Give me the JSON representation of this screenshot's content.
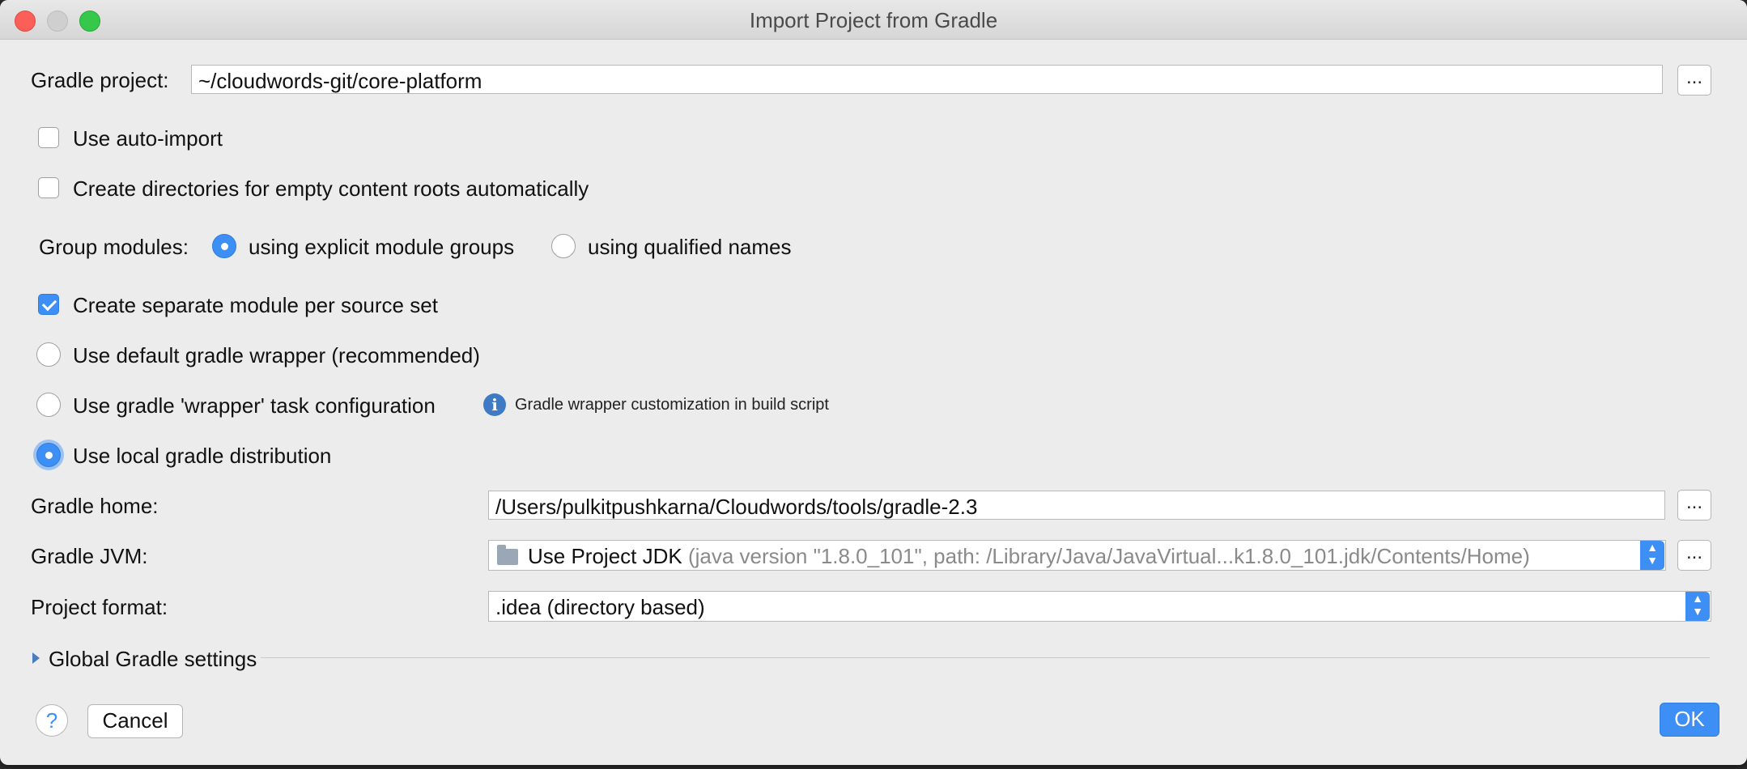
{
  "window": {
    "title": "Import Project from Gradle"
  },
  "gradle_project": {
    "label": "Gradle project:",
    "value": "~/cloudwords-git/core-platform",
    "browse_label": "..."
  },
  "options": {
    "auto_import": {
      "label": "Use auto-import",
      "checked": false
    },
    "create_dirs": {
      "label": "Create directories for empty content roots automatically",
      "checked": false
    },
    "group_modules": {
      "label": "Group modules:",
      "option_explicit": "using explicit module groups",
      "option_qualified": "using qualified names",
      "selected": "using explicit module groups"
    },
    "separate_module": {
      "label": "Create separate module per source set",
      "checked": true
    },
    "default_wrapper": {
      "label": "Use default gradle wrapper (recommended)",
      "selected": false
    },
    "wrapper_task": {
      "label": "Use gradle 'wrapper' task configuration",
      "selected": false,
      "info_text": "Gradle wrapper customization in build script"
    },
    "local_distribution": {
      "label": "Use local gradle distribution",
      "selected": true
    }
  },
  "gradle_home": {
    "label": "Gradle home:",
    "value": "/Users/pulkitpushkarna/Cloudwords/tools/gradle-2.3",
    "browse_label": "..."
  },
  "gradle_jvm": {
    "label": "Gradle JVM:",
    "value_main": "Use Project JDK",
    "value_detail": "(java version \"1.8.0_101\", path: /Library/Java/JavaVirtual...k1.8.0_101.jdk/Contents/Home)",
    "browse_label": "..."
  },
  "project_format": {
    "label": "Project format:",
    "value": ".idea (directory based)"
  },
  "global_settings": {
    "label": "Global Gradle settings"
  },
  "footer": {
    "help_label": "?",
    "cancel_label": "Cancel",
    "ok_label": "OK"
  },
  "colors": {
    "accent": "#3d8ff5",
    "window_bg": "#ececec"
  }
}
